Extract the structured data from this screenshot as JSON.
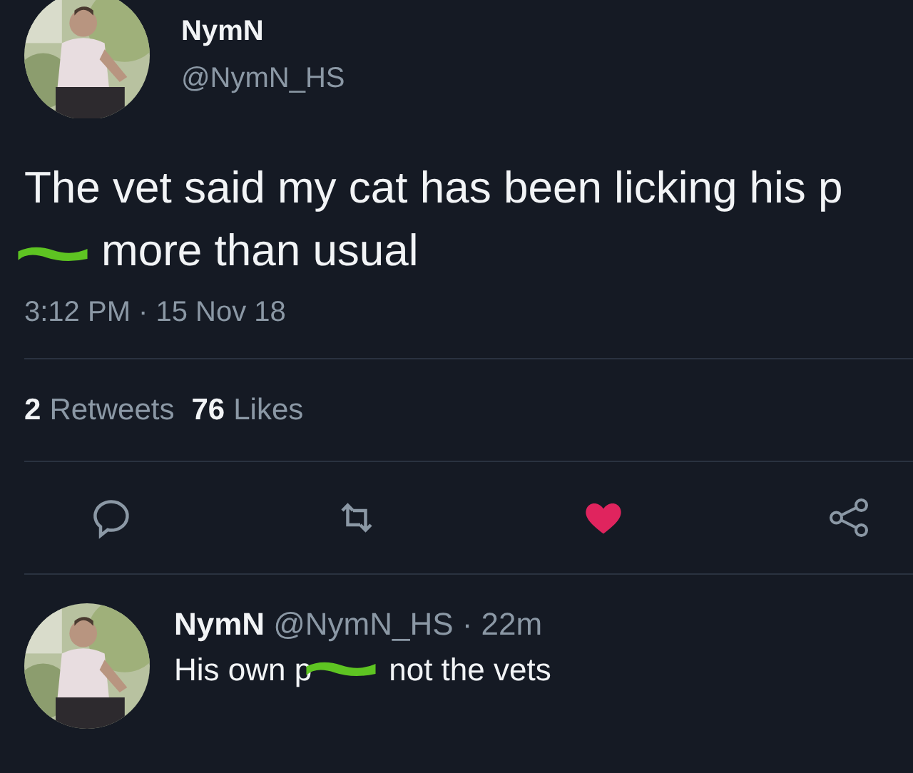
{
  "tweet": {
    "author": {
      "name": "NymN",
      "handle": "@NymN_HS"
    },
    "body": [
      {
        "kind": "text",
        "text": "The vet said my cat has been licking his p"
      },
      {
        "kind": "censored"
      },
      {
        "kind": "text",
        "text": "more than usual"
      }
    ],
    "timestamp": "3:12 PM · 15 Nov 18",
    "stats": [
      {
        "count": "2",
        "label": "Retweets"
      },
      {
        "count": "76",
        "label": "Likes"
      }
    ],
    "actions": [
      {
        "kind": "reply"
      },
      {
        "kind": "retweet"
      },
      {
        "kind": "like",
        "selected": true
      },
      {
        "kind": "share"
      }
    ]
  },
  "reply": {
    "name": "NymN",
    "handle": "@NymN_HS",
    "time": "· 22m",
    "body": [
      {
        "kind": "text",
        "text": "His own p"
      },
      {
        "kind": "censored"
      },
      {
        "kind": "text",
        "text": "not the vets"
      }
    ]
  }
}
